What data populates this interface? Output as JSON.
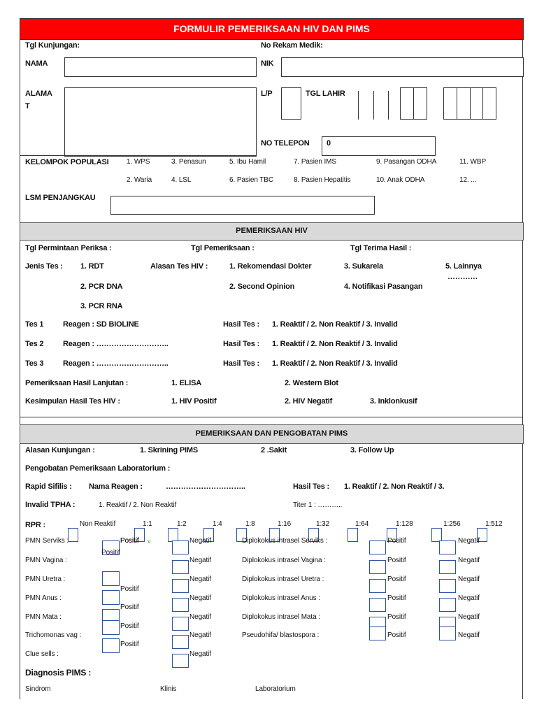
{
  "title": "FORMULIR PEMERIKSAAN HIV DAN PIMS",
  "colors": {
    "header": "#ff0000",
    "section": "#d9d9d9",
    "checkbox": "#2f52a0"
  },
  "identity": {
    "tgl_kunjungan": "Tgl Kunjungan:",
    "no_rekam": "No Rekam Medik:",
    "nama": "NAMA",
    "nik": "NIK",
    "alamat1": "ALAMA",
    "alamat2": "T",
    "lp": "L/P",
    "tgl_lahir": "TGL LAHIR",
    "no_telepon": "NO TELEPON",
    "no_telepon_value": "0",
    "kelompok": "KELOMPOK POPULASI",
    "lsm": "LSM PENJANGKAU"
  },
  "populasi": [
    "1. WPS",
    "3. Penasun",
    "5. Ibu Hamil",
    "7. Pasien IMS",
    "9. Pasangan ODHA",
    "11. WBP",
    "2. Waria",
    "4. LSL",
    "6. Pasien TBC",
    "8. Pasien Hepatitis",
    "10. Anak ODHA",
    "12. ..."
  ],
  "hiv": {
    "title": "PEMERIKSAAN HIV",
    "tgl_permintaan": "Tgl Permintaan Periksa :",
    "tgl_pemeriksaan": "Tgl Pemeriksaan :",
    "tgl_terima": "Tgl Terima Hasil :",
    "jenis_tes": "Jenis Tes :",
    "rdt": "1. RDT",
    "pcr_dna": "2. PCR DNA",
    "pcr_rna": "3. PCR RNA",
    "alasan": "Alasan Tes HIV :",
    "alasan_opts": [
      "1. Rekomendasi Dokter",
      "3. Sukarela",
      "5. Lainnya",
      "…………",
      "2. Second Opinion",
      "4. Notifikasi Pasangan"
    ],
    "tests": [
      {
        "label": "Tes 1",
        "reagen": "Reagen : SD BIOLINE"
      },
      {
        "label": "Tes 2",
        "reagen": "Reagen : ……………………….."
      },
      {
        "label": "Tes 3",
        "reagen": "Reagen : ……………………….."
      }
    ],
    "hasil_label": "Hasil Tes :",
    "hasil_opts": "1. Reaktif / 2. Non Reaktif / 3. Invalid",
    "lanjutan": "Pemeriksaan Hasil Lanjutan :",
    "elisa": "1. ELISA",
    "western": "2. Western Blot",
    "kesimpulan": "Kesimpulan Hasil Tes HIV :",
    "kes_opts": [
      "1. HIV Positif",
      "2. HIV Negatif",
      "3. Inklonkusif"
    ]
  },
  "pims": {
    "title": "PEMERIKSAAN DAN PENGOBATAN PIMS",
    "alasan": "Alasan Kunjungan :",
    "alasan_opts": [
      "1. Skrining PIMS",
      "2 .Sakit",
      "3. Follow Up"
    ],
    "pengobatan": "Pengobatan Pemeriksaan Laboratorium :",
    "rapid": "Rapid Sifilis :",
    "nama_reagen": "Nama Reagen :",
    "reagen_dots": "…………………………..",
    "hasil": "Hasil Tes :",
    "hasil_opts": "1. Reaktif / 2. Non Reaktif / 3.",
    "invalid": "Invalid TPHA :",
    "tpha_opts": "1.  Reaktif / 2. Non Reaktif",
    "titer": "Titer 1 : ………..",
    "rpr": "RPR :",
    "rpr_opts": [
      "Non Reaktif",
      "1:1",
      "1:2",
      "1:4",
      "1:8",
      "1:16",
      "1:32",
      "1:64",
      "1:128",
      "1:256",
      "1:512"
    ],
    "left_rows": [
      "PMN Serviks :",
      "PMN Vagina :",
      "PMN Uretra :",
      "PMN Anus :",
      "PMN Mata :",
      "Trichomonas vag :",
      "Clue sells :"
    ],
    "right_rows": [
      "Diplokokus intrasel Serviks :",
      "Diplokokus intrasel Vagina :",
      "Diplokokus intrasel Uretra :",
      "Diplokokus intrasel Anus :",
      "Diplokokus intrasel Mata :",
      "Pseudohifa/ blastospora :"
    ],
    "positif": "Positif",
    "negatif": "Negatif",
    "check_mark": "v",
    "diagnosis": "Diagnosis PIMS :",
    "sindrom": "Sindrom",
    "klinis": "Klinis",
    "laboratorium": "Laboratorium"
  }
}
